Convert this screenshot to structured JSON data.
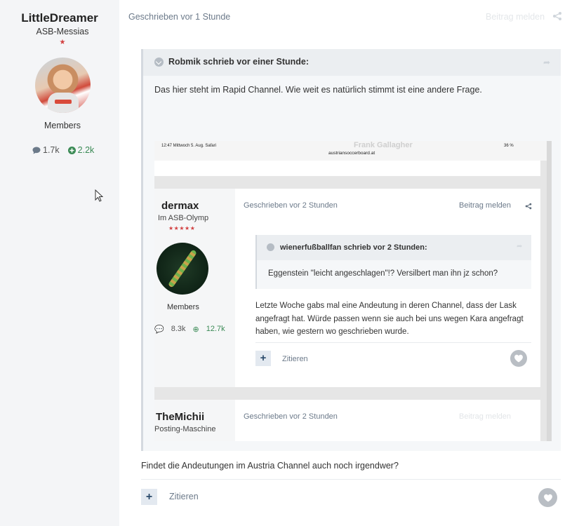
{
  "author": {
    "name": "LittleDreamer",
    "rank": "ASB-Messias",
    "stars": "★",
    "group": "Members",
    "posts": "1.7k",
    "reputation": "2.2k"
  },
  "post": {
    "date": "Geschrieben vor 1 Stunde",
    "report": "Beitrag melden",
    "quote": {
      "title": "Robmik schrieb vor einer Stunde:",
      "text": "Das hier steht im Rapid Channel. Wie weit es natürlich stimmt ist eine andere Frage."
    },
    "screenshot": {
      "status_time": "12:47  Mittwoch 5. Aug.   Safari",
      "status_url": "austriansoccerboard.at",
      "status_blur": "Frank Gallagher",
      "status_battery": "36 %",
      "post1": {
        "username": "dermax",
        "rank": "Im ASB-Olymp",
        "stars": "★★★★★",
        "group": "Members",
        "posts": "8.3k",
        "reputation": "12.7k",
        "date": "Geschrieben vor 2 Stunden",
        "report": "Beitrag melden",
        "quote_title": "wienerfußballfan schrieb vor 2 Stunden:",
        "quote_text": "Eggenstein \"leicht angeschlagen\"!? Versilbert man ihn jz schon?",
        "text": "Letzte Woche gabs mal eine Andeutung in deren Channel, dass der Lask angefragt hat. Würde passen wenn sie auch bei uns wegen Kara angefragt haben, wie gestern wo geschrieben wurde.",
        "quote_label": "Zitieren"
      },
      "post2": {
        "username": "TheMichii",
        "rank": "Posting-Maschine",
        "date": "Geschrieben vor 2 Stunden",
        "report": "Beitrag melden"
      }
    },
    "answer": "Findet die Andeutungen im Austria Channel auch noch irgendwer?",
    "quote_label": "Zitieren"
  },
  "colors": {
    "sidebar_bg": "#f4f5f7",
    "meta_text": "#6c7a8a",
    "reputation_green": "#3a8a55",
    "quote_bg": "#f5f7f9",
    "quote_head_bg": "#ebeef1"
  },
  "icons": [
    "comment-icon",
    "plus-circle-icon",
    "share-icon",
    "chevron-down-icon",
    "reply-arrow-icon",
    "heart-icon",
    "plus-icon",
    "cursor-icon"
  ]
}
